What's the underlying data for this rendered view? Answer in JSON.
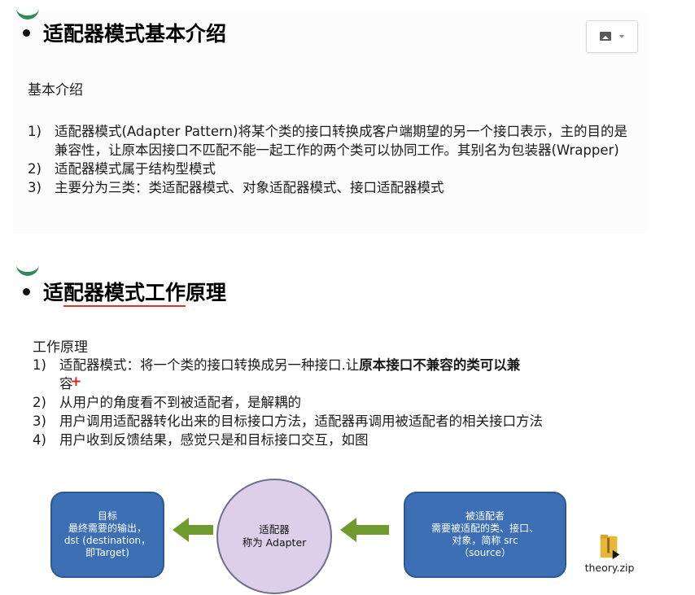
{
  "slide1": {
    "heading": "适配器模式基本介绍",
    "subheading": "基本介绍",
    "items": [
      {
        "num": "1)",
        "text": "适配器模式(Adapter Pattern)将某个类的接口转换成客户端期望的另一个接口表示，主的目的是兼容性，让原本因接口不匹配不能一起工作的两个类可以协同工作。其别名为包装器(Wrapper)"
      },
      {
        "num": "2)",
        "text": "适配器模式属于结构型模式"
      },
      {
        "num": "3)",
        "text": "主要分为三类：类适配器模式、对象适配器模式、接口适配器模式"
      }
    ]
  },
  "slide2": {
    "heading_pre": "适",
    "heading_underlined": "配器模式工作",
    "heading_post": "原理",
    "subheading": "工作原理",
    "item1_num": "1)",
    "item1_text": "适配器模式：将一个类的接口转换成另一种接口.让",
    "item1_bold": "原本接口不兼容的类可以兼",
    "item1_cont": "容",
    "item1_mark": "+",
    "items": [
      {
        "num": "2)",
        "text": "从用户的角度看不到被适配者，是解耦的"
      },
      {
        "num": "3)",
        "text": "用户调用适配器转化出来的目标接口方法，适配器再调用被适配者的相关接口方法"
      },
      {
        "num": "4)",
        "text": "用户收到反馈结果，感觉只是和目标接口交互，如图"
      }
    ]
  },
  "diagram": {
    "target_lines": [
      "目标",
      "最终需要的输出，",
      "dst (destination，",
      "即Target)"
    ],
    "adapter_lines": [
      "适配器",
      "称为 Adapter"
    ],
    "adaptee_lines": [
      "被适配者",
      "需要被适配的类、接口、",
      "对象，简称 src",
      "（source）"
    ],
    "box_color": "#3c6fb4",
    "circle_color": "#ddcfe9",
    "arrow_color": "#6f9a2e"
  },
  "file": {
    "name": "theory.zip"
  }
}
